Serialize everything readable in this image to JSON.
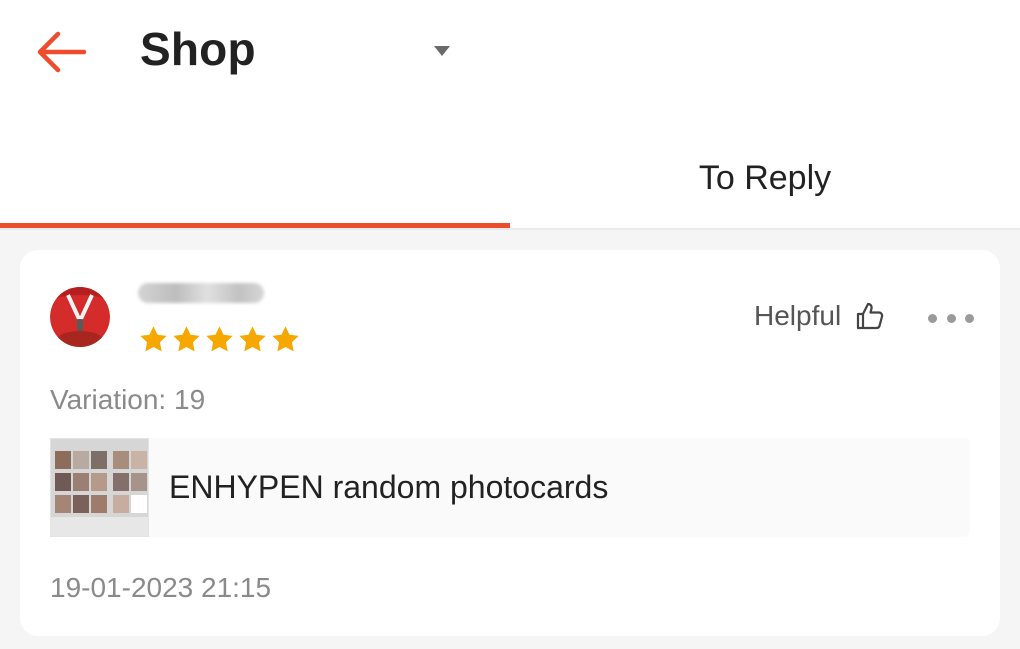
{
  "header": {
    "title": "Shop",
    "back_icon": "arrow-left-icon",
    "dropdown_icon": "caret-down-icon"
  },
  "tabs": [
    {
      "label": "",
      "active": true
    },
    {
      "label": "To Reply",
      "active": false
    }
  ],
  "review": {
    "username": "",
    "rating": 5,
    "rating_max": 5,
    "helpful_label": "Helpful",
    "helpful_icon": "thumbs-up-icon",
    "more_icon": "more-dots-icon",
    "variation": "Variation: 19",
    "product_name": "ENHYPEN random photocards",
    "timestamp": "19-01-2023 21:15"
  },
  "colors": {
    "accent": "#ee4d2d",
    "star": "#f6a700",
    "text_primary": "#222222",
    "text_secondary": "#8a8a8a"
  }
}
